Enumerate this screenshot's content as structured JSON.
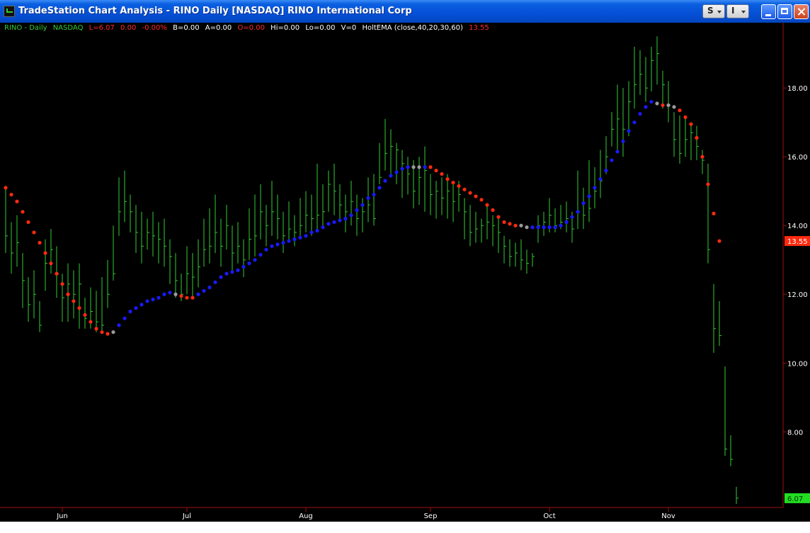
{
  "window": {
    "title": "TradeStation Chart Analysis - RINO Daily [NASDAQ] RINO International Corp",
    "btn_s": "S",
    "btn_i": "I"
  },
  "status_line": {
    "symbol": "RINO - Daily",
    "exchange": "NASDAQ",
    "last": "L=6.07",
    "change": "0.00",
    "change_pct": "-0.00%",
    "bid": "B=0.00",
    "ask": "A=0.00",
    "open": "O=0.00",
    "high": "Hi=0.00",
    "low": "Lo=0.00",
    "volume": "V=0",
    "indicator": "HoltEMA (close,40,20,30,60)",
    "indicator_value": "13.55"
  },
  "colors": {
    "bars": "#33cc33",
    "up": "#1a1aff",
    "down": "#ff2a10",
    "flat": "#9a9a9a",
    "axis": "#a01010"
  },
  "chart_data": {
    "type": "ohlc_bar",
    "title": "RINO - Daily",
    "ylim": [
      5.8,
      19.9
    ],
    "y_ticks": [
      {
        "v": 8,
        "label": "8.00"
      },
      {
        "v": 10,
        "label": "10.00"
      },
      {
        "v": 12,
        "label": "12.00"
      },
      {
        "v": 14,
        "label": "14.00"
      },
      {
        "v": 16,
        "label": "16.00"
      },
      {
        "v": 18,
        "label": "18.00"
      }
    ],
    "x_labels": [
      {
        "i": 10,
        "label": "Jun"
      },
      {
        "i": 32,
        "label": "Jul"
      },
      {
        "i": 53,
        "label": "Aug"
      },
      {
        "i": 75,
        "label": "Sep"
      },
      {
        "i": 96,
        "label": "Oct"
      },
      {
        "i": 117,
        "label": "Nov"
      }
    ],
    "n_bars": 130,
    "price_flags": [
      {
        "v": 13.55,
        "label": "13.55",
        "color": "#ff2a10"
      },
      {
        "v": 6.07,
        "label": "6.07",
        "color": "#22dd22"
      }
    ],
    "close": [
      13.7,
      13.2,
      13.5,
      12.4,
      11.7,
      12.0,
      11.1,
      12.9,
      13.3,
      12.6,
      11.9,
      12.3,
      12.0,
      12.3,
      11.3,
      11.5,
      11.2,
      11.1,
      12.0,
      12.6,
      14.4,
      14.7,
      14.4,
      13.8,
      13.4,
      13.8,
      13.7,
      13.6,
      13.4,
      13.1,
      12.4,
      12.0,
      12.6,
      12.5,
      12.8,
      13.3,
      13.4,
      13.8,
      13.4,
      14.0,
      13.2,
      13.4,
      13.0,
      13.6,
      13.7,
      14.4,
      14.0,
      14.4,
      14.2,
      13.7,
      13.9,
      13.8,
      14.0,
      14.3,
      14.2,
      14.3,
      14.4,
      15.2,
      15.0,
      14.6,
      14.4,
      14.7,
      14.2,
      14.4,
      14.6,
      14.2,
      15.4,
      16.1,
      16.3,
      16.2,
      15.8,
      15.5,
      15.0,
      15.4,
      15.6,
      14.9,
      15.0,
      14.8,
      15.0,
      14.7,
      14.9,
      14.4,
      13.8,
      13.9,
      14.0,
      14.1,
      14.0,
      13.8,
      13.4,
      13.1,
      13.2,
      13.0,
      12.9,
      13.1,
      14.0,
      14.1,
      14.3,
      14.0,
      14.1,
      14.2,
      13.9,
      14.4,
      14.3,
      14.5,
      15.0,
      15.3,
      16.0,
      16.8,
      17.1,
      16.8,
      17.6,
      18.1,
      18.4,
      18.0,
      18.8,
      19.0,
      18.1,
      17.5,
      16.5,
      16.1,
      16.5,
      16.7,
      16.3,
      15.9,
      13.3,
      11.0,
      10.8,
      7.5,
      7.2,
      6.07
    ],
    "high": [
      15.1,
      14.1,
      14.3,
      13.2,
      12.5,
      12.7,
      11.8,
      13.6,
      13.9,
      13.4,
      12.6,
      12.9,
      12.7,
      12.9,
      11.9,
      12.2,
      12.1,
      12.5,
      13.0,
      14.0,
      15.4,
      15.6,
      14.9,
      14.6,
      14.4,
      14.2,
      14.4,
      14.1,
      14.2,
      13.6,
      13.2,
      12.6,
      13.4,
      13.2,
      13.6,
      14.2,
      14.5,
      14.9,
      14.2,
      14.6,
      14.0,
      14.1,
      13.6,
      14.5,
      14.9,
      15.2,
      14.6,
      15.3,
      14.9,
      14.4,
      14.7,
      14.3,
      14.8,
      15.0,
      14.9,
      15.8,
      15.2,
      15.6,
      15.8,
      15.2,
      14.9,
      15.3,
      14.9,
      14.8,
      15.4,
      15.5,
      16.4,
      17.1,
      16.8,
      16.4,
      16.2,
      16.0,
      15.9,
      16.0,
      16.3,
      15.5,
      15.3,
      15.4,
      15.5,
      15.2,
      15.3,
      14.8,
      14.6,
      14.4,
      14.2,
      14.6,
      14.3,
      14.2,
      13.7,
      13.6,
      13.5,
      13.6,
      13.3,
      13.2,
      14.3,
      14.4,
      14.8,
      14.5,
      14.6,
      14.7,
      14.4,
      15.6,
      15.1,
      15.9,
      15.7,
      16.2,
      16.6,
      17.3,
      18.1,
      18.0,
      18.2,
      19.2,
      19.1,
      18.9,
      19.2,
      19.5,
      18.5,
      18.2,
      17.3,
      17.2,
      17.1,
      16.9,
      16.9,
      16.2,
      15.8,
      12.3,
      11.8,
      9.9,
      7.9,
      6.4
    ],
    "low": [
      13.2,
      12.6,
      12.8,
      11.6,
      11.2,
      11.3,
      10.9,
      12.1,
      12.6,
      11.9,
      11.2,
      11.2,
      11.3,
      11.0,
      11.0,
      11.0,
      10.9,
      10.9,
      11.6,
      12.4,
      13.7,
      14.1,
      13.8,
      13.2,
      12.9,
      13.3,
      13.1,
      12.9,
      12.8,
      12.3,
      11.9,
      11.8,
      12.0,
      11.9,
      12.2,
      12.8,
      12.9,
      13.2,
      12.8,
      13.3,
      12.6,
      12.9,
      12.5,
      13.0,
      13.1,
      13.6,
      13.4,
      13.7,
      13.6,
      13.2,
      13.5,
      13.4,
      13.6,
      13.8,
      13.7,
      13.9,
      13.9,
      14.4,
      14.3,
      14.1,
      13.8,
      14.0,
      13.7,
      13.8,
      14.1,
      14.0,
      15.2,
      15.6,
      15.4,
      15.2,
      14.8,
      14.9,
      14.5,
      14.6,
      14.4,
      14.3,
      14.2,
      14.3,
      14.2,
      14.1,
      14.4,
      13.6,
      13.4,
      13.5,
      13.5,
      13.6,
      13.4,
      13.2,
      12.9,
      12.8,
      12.8,
      12.7,
      12.6,
      12.8,
      13.5,
      13.7,
      13.8,
      13.8,
      13.9,
      13.8,
      13.5,
      13.9,
      13.9,
      14.1,
      14.5,
      14.8,
      15.5,
      16.3,
      16.2,
      16.0,
      16.6,
      17.4,
      17.8,
      17.6,
      17.9,
      18.1,
      17.4,
      17.0,
      16.0,
      15.8,
      16.0,
      15.9,
      15.9,
      15.5,
      12.9,
      10.3,
      10.5,
      7.3,
      7.0,
      5.9
    ],
    "holt": [
      15.1,
      14.9,
      14.7,
      14.4,
      14.1,
      13.8,
      13.5,
      13.2,
      12.9,
      12.6,
      12.3,
      12.0,
      11.8,
      11.6,
      11.4,
      11.2,
      11.0,
      10.9,
      10.85,
      10.9,
      11.1,
      11.3,
      11.5,
      11.6,
      11.7,
      11.8,
      11.85,
      11.9,
      12.0,
      12.05,
      12.0,
      11.95,
      11.9,
      11.9,
      12.0,
      12.1,
      12.2,
      12.35,
      12.5,
      12.6,
      12.65,
      12.7,
      12.8,
      12.9,
      13.0,
      13.15,
      13.3,
      13.4,
      13.45,
      13.5,
      13.55,
      13.6,
      13.65,
      13.7,
      13.8,
      13.85,
      13.95,
      14.05,
      14.1,
      14.15,
      14.2,
      14.3,
      14.45,
      14.6,
      14.8,
      14.9,
      15.1,
      15.3,
      15.45,
      15.55,
      15.65,
      15.7,
      15.7,
      15.7,
      15.7,
      15.7,
      15.6,
      15.5,
      15.35,
      15.25,
      15.15,
      15.05,
      14.95,
      14.85,
      14.75,
      14.6,
      14.45,
      14.25,
      14.1,
      14.05,
      14.0,
      14.0,
      13.95,
      13.95,
      13.95,
      13.95,
      13.95,
      13.95,
      14.0,
      14.1,
      14.25,
      14.4,
      14.65,
      14.85,
      15.1,
      15.35,
      15.6,
      15.9,
      16.15,
      16.45,
      16.75,
      17.0,
      17.25,
      17.45,
      17.6,
      17.55,
      17.5,
      17.5,
      17.45,
      17.35,
      17.15,
      16.95,
      16.55,
      16.0,
      15.2,
      14.35,
      13.55
    ],
    "holt_state": [
      "down",
      "down",
      "down",
      "down",
      "down",
      "down",
      "down",
      "down",
      "down",
      "down",
      "down",
      "down",
      "down",
      "down",
      "down",
      "down",
      "down",
      "down",
      "down",
      "flat",
      "up",
      "up",
      "up",
      "up",
      "up",
      "up",
      "up",
      "up",
      "up",
      "up",
      "flat",
      "down",
      "down",
      "down",
      "up",
      "up",
      "up",
      "up",
      "up",
      "up",
      "up",
      "up",
      "up",
      "up",
      "up",
      "up",
      "up",
      "up",
      "up",
      "up",
      "up",
      "up",
      "up",
      "up",
      "up",
      "up",
      "up",
      "up",
      "up",
      "up",
      "up",
      "up",
      "up",
      "up",
      "up",
      "up",
      "up",
      "up",
      "up",
      "up",
      "up",
      "up",
      "flat",
      "flat",
      "up",
      "down",
      "down",
      "down",
      "down",
      "down",
      "down",
      "down",
      "down",
      "down",
      "down",
      "down",
      "down",
      "down",
      "down",
      "down",
      "down",
      "flat",
      "flat",
      "up",
      "up",
      "up",
      "up",
      "up",
      "up",
      "up",
      "up",
      "up",
      "up",
      "up",
      "up",
      "up",
      "up",
      "up",
      "up",
      "up",
      "up",
      "up",
      "up",
      "up",
      "up",
      "flat",
      "down",
      "flat",
      "flat",
      "down",
      "down",
      "down",
      "down",
      "down",
      "down",
      "down",
      "down"
    ]
  }
}
